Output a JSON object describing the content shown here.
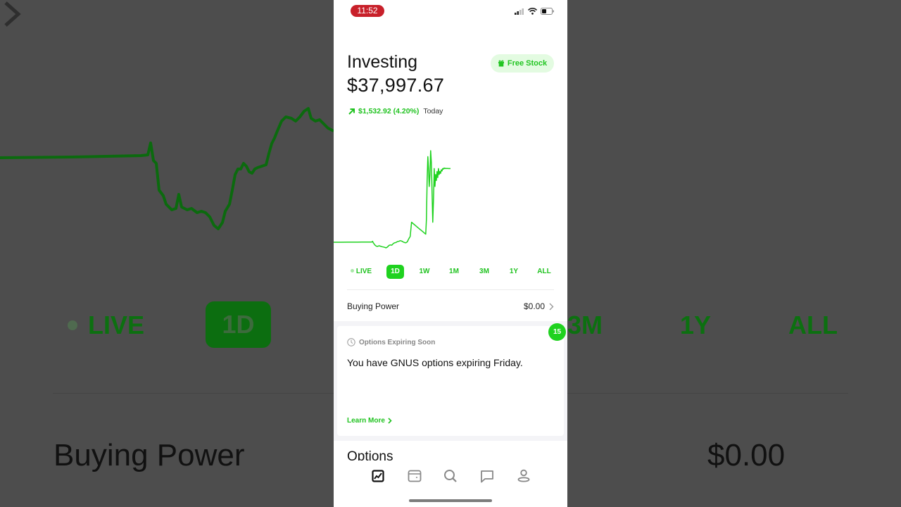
{
  "status_bar": {
    "time": "11:52",
    "icons": [
      "signal-icon",
      "wifi-icon",
      "battery-icon"
    ]
  },
  "header": {
    "title": "Investing",
    "balance": "$37,997.67",
    "free_stock_label": "Free Stock",
    "change_value": "$1,532.92 (4.20%)",
    "change_period": "Today",
    "change_direction": "up"
  },
  "chart_data": {
    "type": "line",
    "title": "",
    "xlabel": "",
    "ylabel": "",
    "period": "1D",
    "color": "#1fd21f",
    "note": "relative shape of intraday portfolio value; no axis labels shown",
    "x": [
      0,
      10,
      20,
      30,
      40,
      50,
      54,
      55,
      56,
      57,
      58,
      59,
      60,
      62,
      64,
      66,
      68,
      70,
      72,
      74,
      76,
      78,
      80,
      82,
      84,
      86,
      88,
      90,
      92,
      94,
      96,
      98,
      100,
      102,
      104,
      106,
      108,
      110,
      112,
      114,
      116,
      118,
      120,
      122,
      124,
      126,
      128,
      130,
      131,
      132,
      133,
      134,
      135,
      136,
      137,
      138,
      139,
      140,
      141,
      142,
      143,
      144,
      145,
      146,
      147,
      148,
      149,
      150,
      151,
      152,
      153,
      154,
      155,
      156,
      157,
      158,
      159,
      160,
      161,
      162,
      163,
      164,
      165
    ],
    "values": [
      36465,
      36465,
      36466,
      36466,
      36467,
      36468,
      36468,
      36480,
      36455,
      36440,
      36420,
      36410,
      36400,
      36395,
      36405,
      36398,
      36390,
      36385,
      36380,
      36370,
      36385,
      36410,
      36420,
      36415,
      36440,
      36455,
      36460,
      36475,
      36480,
      36490,
      36485,
      36470,
      36460,
      36455,
      36470,
      36520,
      36560,
      36800,
      36780,
      36760,
      36740,
      36720,
      36700,
      36680,
      36660,
      36640,
      36620,
      36600,
      36850,
      37500,
      37900,
      37700,
      37400,
      37600,
      38000,
      37800,
      37300,
      36800,
      37200,
      37700,
      37400,
      37600,
      37500,
      37650,
      37550,
      37700,
      37600,
      37650,
      37620,
      37680,
      37660,
      37700,
      37690,
      37710,
      37700,
      37705,
      37700,
      37702,
      37701,
      37700,
      37700,
      37700,
      37700
    ]
  },
  "ranges": [
    {
      "label": "LIVE",
      "active": false,
      "live_dot": true
    },
    {
      "label": "1D",
      "active": true
    },
    {
      "label": "1W",
      "active": false
    },
    {
      "label": "1M",
      "active": false
    },
    {
      "label": "3M",
      "active": false
    },
    {
      "label": "1Y",
      "active": false
    },
    {
      "label": "ALL",
      "active": false
    }
  ],
  "buying_power": {
    "label": "Buying Power",
    "value": "$0.00"
  },
  "card": {
    "badge_count": "15",
    "heading": "Options Expiring Soon",
    "message": "You have GNUS options expiring Friday.",
    "link_label": "Learn More"
  },
  "options_section": {
    "title": "Options"
  },
  "tabbar": {
    "items": [
      {
        "name": "investing",
        "icon": "chart-icon",
        "active": true
      },
      {
        "name": "wallet",
        "icon": "wallet-icon",
        "active": false
      },
      {
        "name": "search",
        "icon": "search-icon",
        "active": false
      },
      {
        "name": "messages",
        "icon": "chat-icon",
        "active": false
      },
      {
        "name": "account",
        "icon": "person-icon",
        "active": false
      }
    ]
  },
  "colors": {
    "accent": "#1fd21f",
    "accent_text": "#1fc21f",
    "free_stock_bg": "#e3fbe1",
    "time_pill": "#c8202a"
  }
}
